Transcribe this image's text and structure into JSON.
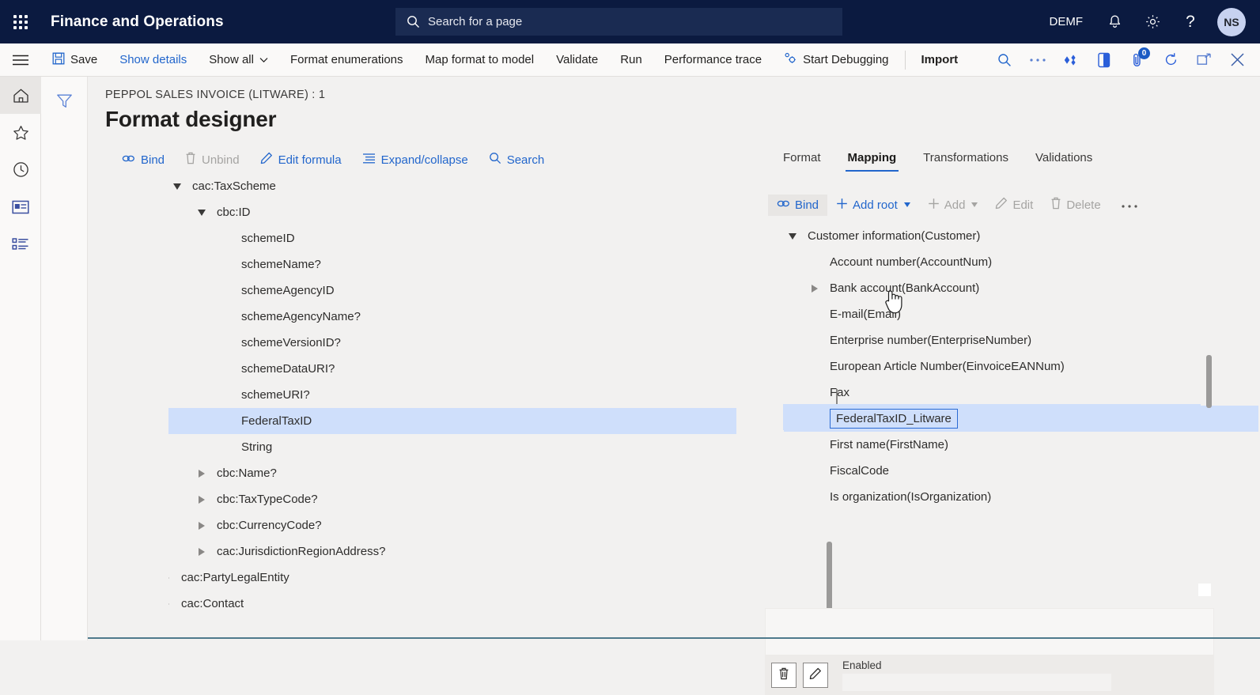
{
  "topbar": {
    "waffle_icon": "app-launcher-icon",
    "app_title": "Finance and Operations",
    "search": {
      "icon": "search-icon",
      "placeholder": "Search for a page"
    },
    "company": "DEMF",
    "notifications_icon": "bell-icon",
    "settings_icon": "gear-icon",
    "help_icon": "question-mark-icon",
    "avatar_initials": "NS"
  },
  "commandbar": {
    "hamburger_icon": "hamburger-menu-icon",
    "buttons": [
      {
        "label": "Save",
        "icon": "save-icon",
        "style": "default"
      },
      {
        "label": "Show details",
        "icon": "",
        "style": "link"
      },
      {
        "label": "Show all",
        "icon": "",
        "style": "default",
        "chevron": true
      },
      {
        "label": "Format enumerations",
        "icon": "",
        "style": "default"
      },
      {
        "label": "Map format to model",
        "icon": "",
        "style": "default"
      },
      {
        "label": "Validate",
        "icon": "",
        "style": "default"
      },
      {
        "label": "Run",
        "icon": "",
        "style": "default"
      },
      {
        "label": "Performance trace",
        "icon": "",
        "style": "default"
      },
      {
        "label": "Start Debugging",
        "icon": "debug-icon",
        "style": "default"
      },
      {
        "label": "Import",
        "icon": "",
        "style": "bold"
      }
    ],
    "right_icons": [
      {
        "name": "search-icon"
      },
      {
        "name": "overflow-ellipsis-icon"
      },
      {
        "name": "share-icon"
      },
      {
        "name": "office-app-icon"
      },
      {
        "name": "attachments-icon",
        "badge": "0"
      },
      {
        "name": "refresh-icon"
      },
      {
        "name": "popout-icon"
      },
      {
        "name": "close-icon"
      }
    ]
  },
  "rail": {
    "items": [
      {
        "name": "home-icon",
        "active": true
      },
      {
        "name": "favorites-star-icon",
        "active": false
      },
      {
        "name": "recent-clock-icon",
        "active": false
      },
      {
        "name": "workspaces-icon",
        "active": false
      },
      {
        "name": "modules-list-icon",
        "active": false
      }
    ],
    "filter_icon": "filter-funnel-icon"
  },
  "page": {
    "breadcrumb": "PEPPOL SALES INVOICE (LITWARE) : 1",
    "title": "Format designer"
  },
  "left_toolbar": [
    {
      "label": "Bind",
      "icon": "bind-link-icon",
      "disabled": false
    },
    {
      "label": "Unbind",
      "icon": "trash-icon",
      "disabled": true
    },
    {
      "label": "Edit formula",
      "icon": "pencil-icon",
      "disabled": false
    },
    {
      "label": "Expand/collapse",
      "icon": "list-lines-icon",
      "disabled": false
    },
    {
      "label": "Search",
      "icon": "search-icon",
      "disabled": false
    }
  ],
  "left_tree": {
    "rows": [
      {
        "label": "cac:TaxScheme",
        "indent": 0,
        "toggle": "down",
        "selected": false
      },
      {
        "label": "cbc:ID",
        "indent": 1,
        "toggle": "down",
        "selected": false
      },
      {
        "label": "schemeID",
        "indent": 2,
        "toggle": "none",
        "selected": false
      },
      {
        "label": "schemeName?",
        "indent": 2,
        "toggle": "none",
        "selected": false
      },
      {
        "label": "schemeAgencyID",
        "indent": 2,
        "toggle": "none",
        "selected": false
      },
      {
        "label": "schemeAgencyName?",
        "indent": 2,
        "toggle": "none",
        "selected": false
      },
      {
        "label": "schemeVersionID?",
        "indent": 2,
        "toggle": "none",
        "selected": false
      },
      {
        "label": "schemeDataURI?",
        "indent": 2,
        "toggle": "none",
        "selected": false
      },
      {
        "label": "schemeURI?",
        "indent": 2,
        "toggle": "none",
        "selected": false
      },
      {
        "label": "FederalTaxID",
        "indent": 2,
        "toggle": "none",
        "selected": true
      },
      {
        "label": "String",
        "indent": 2,
        "toggle": "none",
        "selected": false
      },
      {
        "label": "cbc:Name?",
        "indent": 1,
        "toggle": "right",
        "selected": false
      },
      {
        "label": "cbc:TaxTypeCode?",
        "indent": 1,
        "toggle": "right",
        "selected": false
      },
      {
        "label": "cbc:CurrencyCode?",
        "indent": 1,
        "toggle": "right",
        "selected": false
      },
      {
        "label": "cac:JurisdictionRegionAddress?",
        "indent": 1,
        "toggle": "right",
        "selected": false
      },
      {
        "label": "cac:PartyLegalEntity",
        "indent": 0,
        "toggle": "right",
        "selected": false
      },
      {
        "label": "cac:Contact",
        "indent": 0,
        "toggle": "right",
        "selected": false
      }
    ]
  },
  "right_panel": {
    "tabs": [
      {
        "label": "Format",
        "active": false
      },
      {
        "label": "Mapping",
        "active": true
      },
      {
        "label": "Transformations",
        "active": false
      },
      {
        "label": "Validations",
        "active": false
      }
    ],
    "toolbar": [
      {
        "label": "Bind",
        "icon": "bind-link-icon",
        "disabled": false,
        "highlighted": true,
        "chevron": false
      },
      {
        "label": "Add root",
        "icon": "plus-icon",
        "disabled": false,
        "highlighted": false,
        "chevron": true
      },
      {
        "label": "Add",
        "icon": "plus-icon",
        "disabled": true,
        "highlighted": false,
        "chevron": true
      },
      {
        "label": "Edit",
        "icon": "pencil-icon",
        "disabled": true,
        "highlighted": false,
        "chevron": false
      },
      {
        "label": "Delete",
        "icon": "trash-icon",
        "disabled": true,
        "highlighted": false,
        "chevron": false
      },
      {
        "label": "···",
        "icon": "overflow-ellipsis-icon",
        "disabled": false,
        "highlighted": false,
        "chevron": false
      }
    ],
    "tree": {
      "rows": [
        {
          "label": "Customer information(Customer)",
          "indent": 0,
          "toggle": "down",
          "selected": false
        },
        {
          "label": "Account number(AccountNum)",
          "indent": 1,
          "toggle": "none",
          "selected": false
        },
        {
          "label": "Bank account(BankAccount)",
          "indent": 1,
          "toggle": "right",
          "selected": false
        },
        {
          "label": "E-mail(Email)",
          "indent": 1,
          "toggle": "none",
          "selected": false
        },
        {
          "label": "Enterprise number(EnterpriseNumber)",
          "indent": 1,
          "toggle": "none",
          "selected": false
        },
        {
          "label": "European Article Number(EinvoiceEANNum)",
          "indent": 1,
          "toggle": "none",
          "selected": false
        },
        {
          "label": "Fax",
          "indent": 1,
          "toggle": "none",
          "selected": false
        },
        {
          "label": "FederalTaxID_Litware",
          "indent": 1,
          "toggle": "none",
          "selected": true
        },
        {
          "label": "First name(FirstName)",
          "indent": 1,
          "toggle": "none",
          "selected": false
        },
        {
          "label": "FiscalCode",
          "indent": 1,
          "toggle": "none",
          "selected": false
        },
        {
          "label": "Is organization(IsOrganization)",
          "indent": 1,
          "toggle": "none",
          "selected": false
        }
      ]
    },
    "footer": {
      "delete_icon": "trash-icon",
      "edit_icon": "pencil-icon",
      "enabled_label": "Enabled",
      "enabled_value": ""
    }
  },
  "colors": {
    "nav_bg": "#0b1a40",
    "accent": "#2266cc",
    "selection": "#cfdffb",
    "page_bg": "#f2f1f0"
  }
}
